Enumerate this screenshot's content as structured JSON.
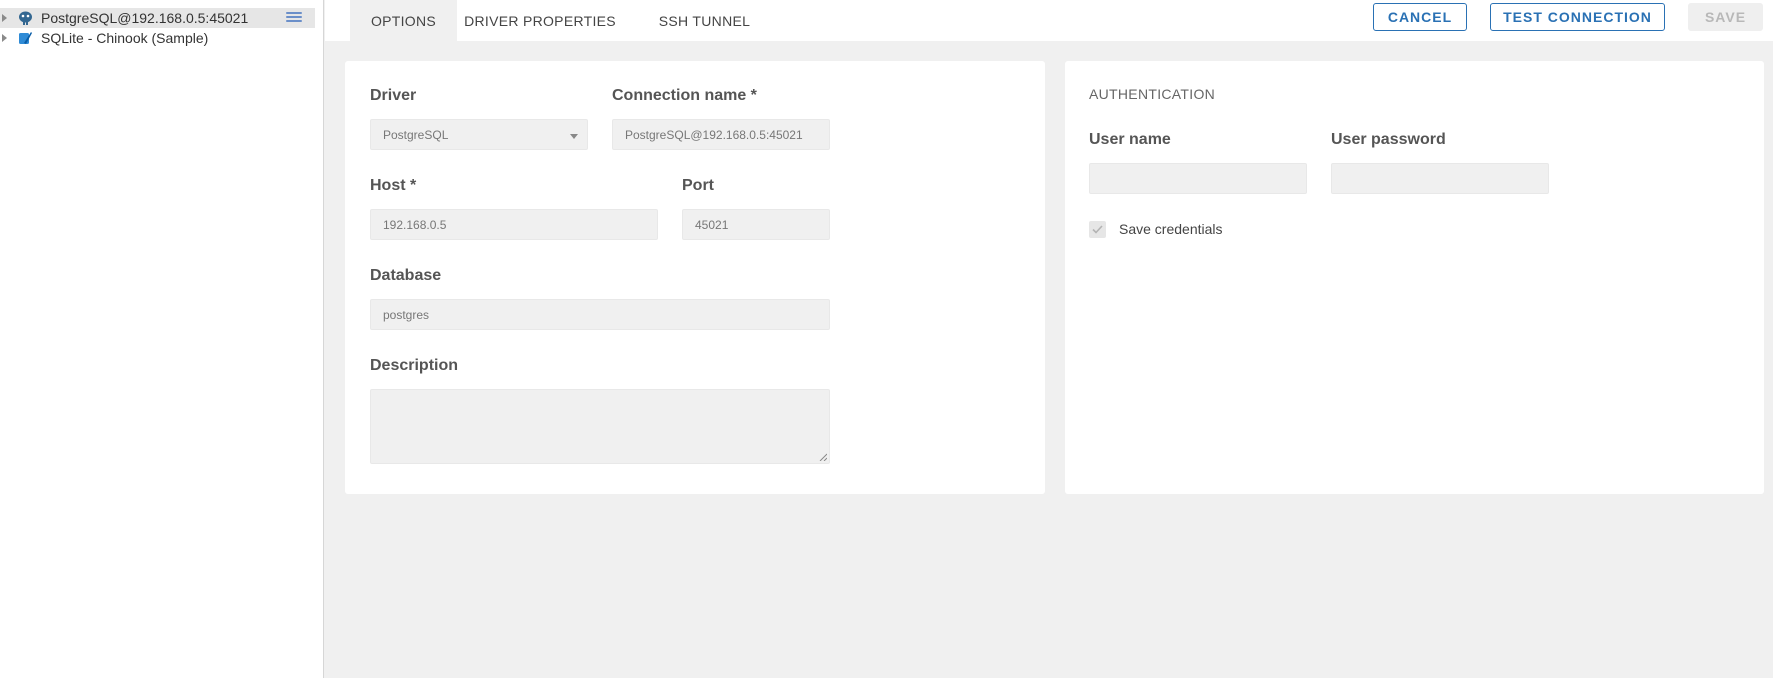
{
  "sidebar": {
    "items": [
      {
        "label": "PostgreSQL@192.168.0.5:45021",
        "icon": "postgresql-icon",
        "selected": true
      },
      {
        "label": "SQLite - Chinook (Sample)",
        "icon": "sqlite-icon",
        "selected": false
      }
    ]
  },
  "tabs": [
    {
      "label": "OPTIONS",
      "active": true
    },
    {
      "label": "DRIVER PROPERTIES",
      "active": false
    },
    {
      "label": "SSH TUNNEL",
      "active": false
    }
  ],
  "actions": {
    "cancel": "CANCEL",
    "test_connection": "TEST CONNECTION",
    "save": "SAVE"
  },
  "options": {
    "driver_label": "Driver",
    "driver_value": "PostgreSQL",
    "connection_name_label": "Connection name *",
    "connection_name_value": "PostgreSQL@192.168.0.5:45021",
    "host_label": "Host *",
    "host_value": "192.168.0.5",
    "port_label": "Port",
    "port_value": "45021",
    "database_label": "Database",
    "database_value": "postgres",
    "description_label": "Description",
    "description_value": ""
  },
  "auth": {
    "title": "AUTHENTICATION",
    "user_name_label": "User name",
    "user_name_value": "",
    "user_password_label": "User password",
    "user_password_value": "",
    "save_credentials_label": "Save credentials",
    "save_credentials_checked": true
  },
  "colors": {
    "accent": "#2a71b4",
    "background": "#f0f0f0",
    "panel": "#ffffff"
  }
}
